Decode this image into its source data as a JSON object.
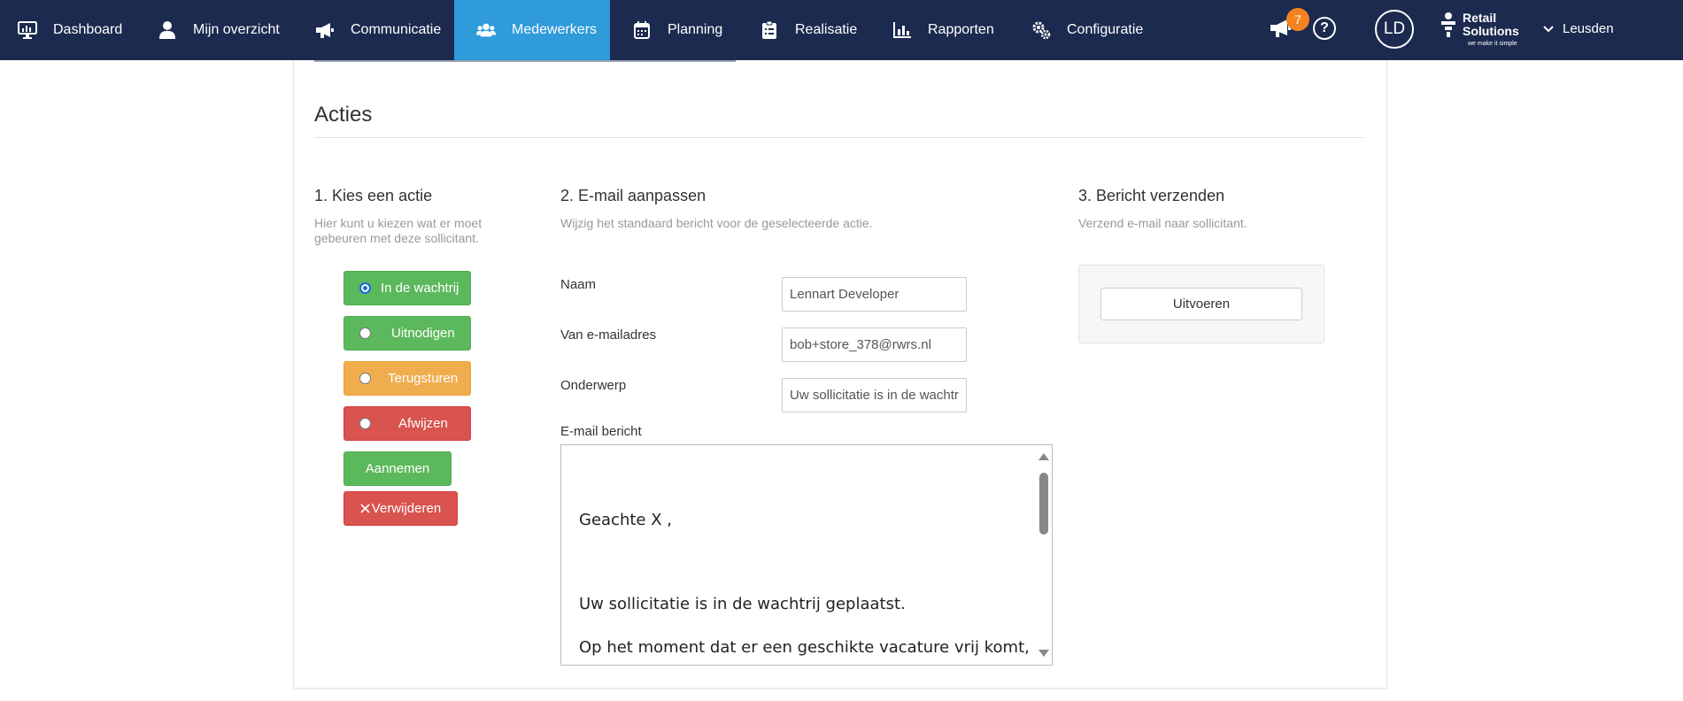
{
  "nav": {
    "items": [
      {
        "label": "Dashboard",
        "icon": "monitor-icon"
      },
      {
        "label": "Mijn overzicht",
        "icon": "user-icon"
      },
      {
        "label": "Communicatie",
        "icon": "megaphone-icon"
      },
      {
        "label": "Medewerkers",
        "icon": "users-icon",
        "active": true
      },
      {
        "label": "Planning",
        "icon": "calendar-icon"
      },
      {
        "label": "Realisatie",
        "icon": "clipboard-icon"
      },
      {
        "label": "Rapporten",
        "icon": "bar-chart-icon"
      },
      {
        "label": "Configuratie",
        "icon": "gears-icon"
      }
    ],
    "notifications_count": "7",
    "help_symbol": "?",
    "avatar_initials": "LD",
    "brand_line1": "Retail",
    "brand_line2": "Solutions",
    "brand_tagline": "we make it simple",
    "store": "Leusden",
    "colors": {
      "bar": "#1b2a4e",
      "active": "#2f9bdb",
      "badge": "#f58220"
    }
  },
  "section": {
    "title": "Acties"
  },
  "step1": {
    "title": "1. Kies een actie",
    "desc_line1": "Hier kunt u kiezen wat er moet",
    "desc_line2": "gebeuren met deze sollicitant.",
    "actions": [
      {
        "label": "In de wachtrij",
        "selected": true,
        "color": "#5cb85c"
      },
      {
        "label": "Uitnodigen",
        "selected": false,
        "color": "#5cb85c"
      },
      {
        "label": "Terugsturen",
        "selected": false,
        "color": "#f0ad4e"
      },
      {
        "label": "Afwijzen",
        "selected": false,
        "color": "#d9534f"
      }
    ],
    "aannemen_label": "Aannemen",
    "verwijderen_label": "Verwijderen"
  },
  "step2": {
    "title": "2. E-mail aanpassen",
    "desc": "Wijzig het standaard bericht voor de geselecteerde actie.",
    "naam_label": "Naam",
    "naam_value": "Lennart Developer",
    "van_label": "Van e-mailadres",
    "van_value": "bob+store_378@rwrs.nl",
    "onderwerp_label": "Onderwerp",
    "onderwerp_value": "Uw sollicitatie is in de wachtr",
    "bericht_label": "E-mail bericht",
    "bericht_line1": "Geachte X ,",
    "bericht_line2": "Uw sollicitatie is in de wachtrij geplaatst.",
    "bericht_line3": "Op het moment dat er een geschikte vacature vrij komt,"
  },
  "step3": {
    "title": "3. Bericht verzenden",
    "desc": "Verzend e-mail naar sollicitant.",
    "button_label": "Uitvoeren"
  }
}
